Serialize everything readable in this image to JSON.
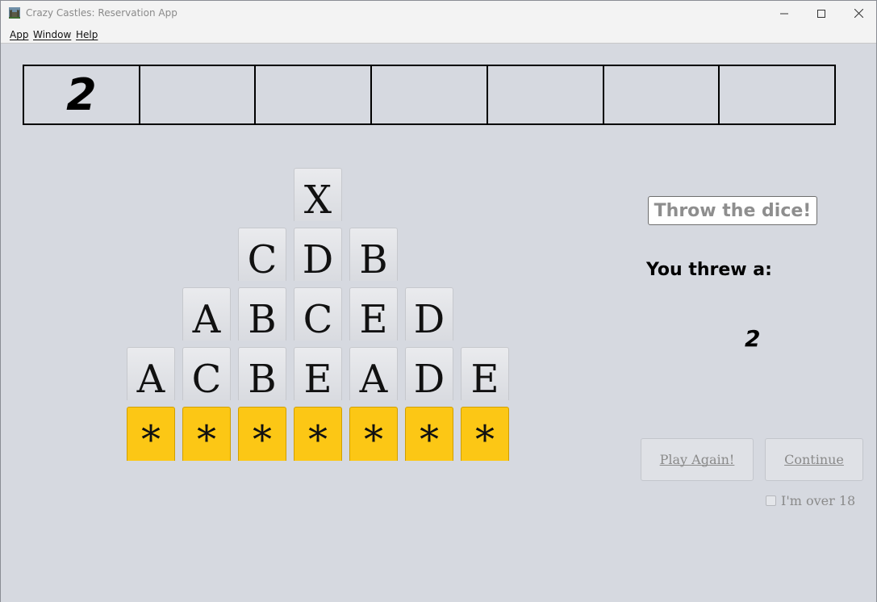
{
  "window": {
    "title": "Crazy Castles: Reservation App",
    "icon": "castle-icon"
  },
  "menu": {
    "items": [
      {
        "label": "App"
      },
      {
        "label": "Window"
      },
      {
        "label": "Help"
      }
    ]
  },
  "scoreboard": {
    "cells": [
      "2",
      "",
      "",
      "",
      "",
      "",
      ""
    ]
  },
  "pyramid": {
    "row1": [
      "X"
    ],
    "row2": [
      "C",
      "D",
      "B"
    ],
    "row3": [
      "A",
      "B",
      "C",
      "E",
      "D"
    ],
    "row4": [
      "A",
      "C",
      "B",
      "E",
      "A",
      "D",
      "E"
    ],
    "base": [
      "*",
      "*",
      "*",
      "*",
      "*",
      "*",
      "*"
    ]
  },
  "controls": {
    "throw_label": "Throw the dice!",
    "threw_label": "You threw a:",
    "threw_value": "2",
    "play_again_label": "Play Again!",
    "continue_label": "Continue",
    "over18_label": "I'm over 18"
  },
  "colors": {
    "background": "#d6d9e0",
    "gold_tile": "#fcc715",
    "disabled_text": "#8a8a8a"
  }
}
